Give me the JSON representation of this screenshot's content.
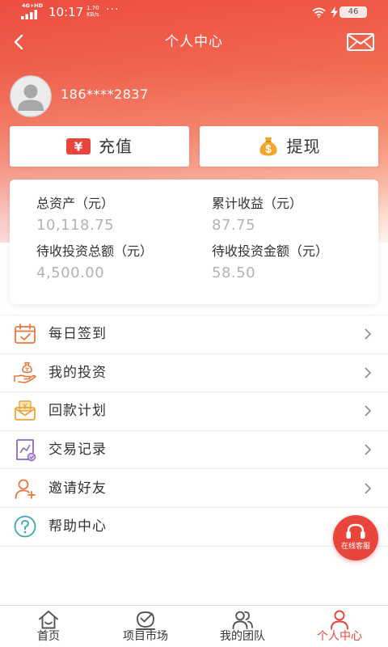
{
  "status_bar": {
    "network": "4G+HD",
    "time": "10:17",
    "speed_value": "1.70",
    "speed_unit": "KB/s",
    "more": "···",
    "battery": "46"
  },
  "header": {
    "back_icon": "back-arrow-icon",
    "title": "个人中心",
    "mail_icon": "mail-icon"
  },
  "profile": {
    "avatar_icon": "avatar-placeholder-icon",
    "phone": "186****2837"
  },
  "actions": {
    "recharge": {
      "label": "充值",
      "icon": "yuan-badge-icon",
      "icon_glyph": "¥"
    },
    "withdraw": {
      "label": "提现",
      "icon": "money-bag-icon"
    }
  },
  "assets": [
    {
      "label": "总资产（元）",
      "value": "10,118.75"
    },
    {
      "label": "累计收益（元）",
      "value": "87.75"
    },
    {
      "label": "待收投资总额（元）",
      "value": "4,500.00"
    },
    {
      "label": "待收投资金额（元）",
      "value": "58.50"
    }
  ],
  "menu": [
    {
      "label": "每日签到",
      "icon": "calendar-check-icon"
    },
    {
      "label": "我的投资",
      "icon": "hand-money-icon"
    },
    {
      "label": "回款计划",
      "icon": "envelope-coin-icon"
    },
    {
      "label": "交易记录",
      "icon": "chart-document-icon"
    },
    {
      "label": "邀请好友",
      "icon": "add-friend-icon"
    },
    {
      "label": "帮助中心",
      "icon": "help-icon"
    }
  ],
  "chat": {
    "label": "在线客服",
    "icon": "headset-icon"
  },
  "nav": {
    "active_index": 3,
    "items": [
      {
        "label": "首页",
        "icon": "home-icon"
      },
      {
        "label": "项目市场",
        "icon": "market-icon"
      },
      {
        "label": "我的团队",
        "icon": "team-icon"
      },
      {
        "label": "个人中心",
        "icon": "profile-icon"
      }
    ]
  },
  "colors": {
    "accent": "#e8463c",
    "hero_top": "#ee5142",
    "value_text": "#b3b3b3",
    "money_bag": "#f4a62a"
  }
}
